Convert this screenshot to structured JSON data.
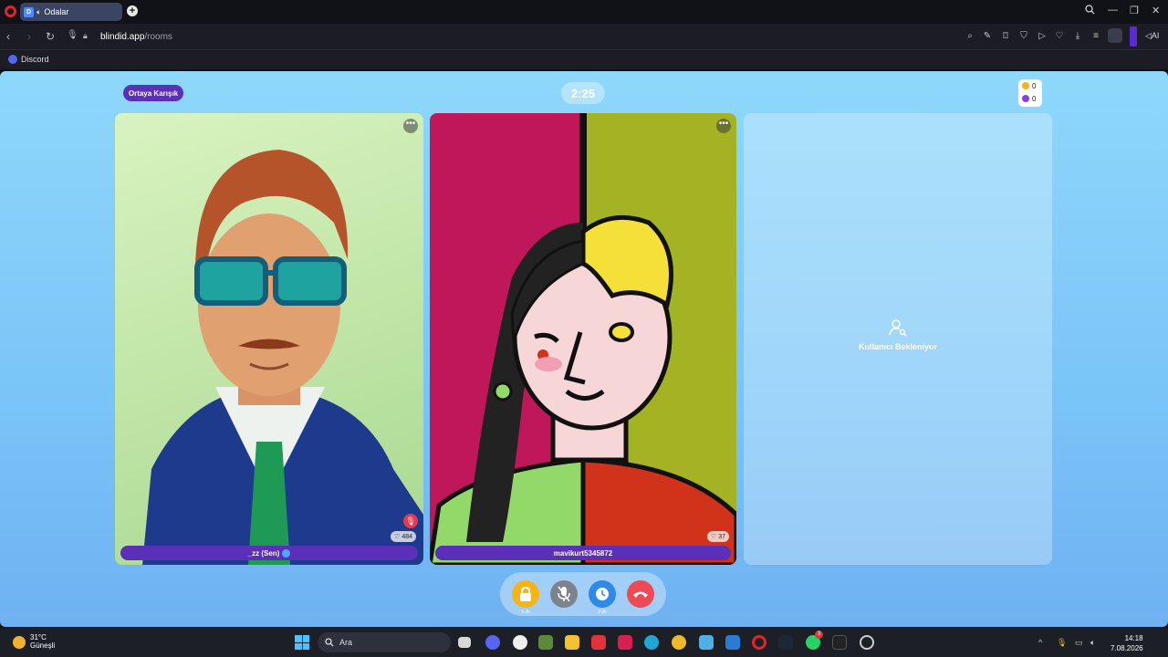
{
  "browser": {
    "tab_title": "Odalar",
    "new_tab": "+",
    "url_host": "blindid.app",
    "url_path": "/rooms",
    "ai_label": "AI",
    "bookmarks": [
      "Discord"
    ]
  },
  "room": {
    "mode": "Ortaya Karışık",
    "timer": "2:25",
    "coins": "0",
    "gems": "0"
  },
  "participants": [
    {
      "name": "_zz (Sen)",
      "likes": "484",
      "verified": true,
      "muted": true
    },
    {
      "name": "mavikurt5345872",
      "likes": "37"
    }
  ],
  "waiting_text": "Kullanıcı Bekleniyor",
  "controls": {
    "lock_label": "5 dk",
    "time_label": "2 dk"
  },
  "taskbar": {
    "temperature": "31°C",
    "weather": "Güneşli",
    "search_placeholder": "Ara",
    "time": "14:18",
    "date": "7.08.2026",
    "whatsapp_badge": "3"
  }
}
